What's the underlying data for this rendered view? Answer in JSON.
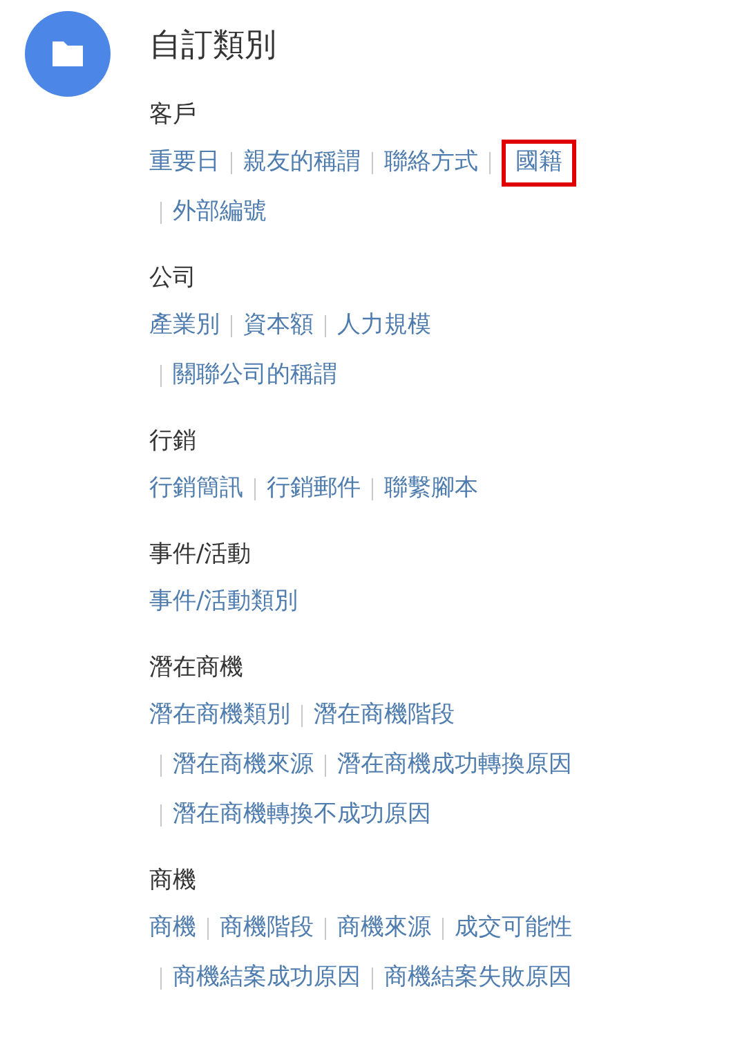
{
  "title": "自訂類別",
  "sections": [
    {
      "heading": "客戶",
      "lines": [
        [
          {
            "label": "重要日",
            "highlighted": false
          },
          {
            "label": "親友的稱謂",
            "highlighted": false
          },
          {
            "label": "聯絡方式",
            "highlighted": false
          },
          {
            "label": "國籍",
            "highlighted": true
          }
        ],
        [
          {
            "label": "外部編號",
            "highlighted": false
          }
        ]
      ]
    },
    {
      "heading": "公司",
      "lines": [
        [
          {
            "label": "產業別",
            "highlighted": false
          },
          {
            "label": "資本額",
            "highlighted": false
          },
          {
            "label": "人力規模",
            "highlighted": false
          }
        ],
        [
          {
            "label": "關聯公司的稱謂",
            "highlighted": false
          }
        ]
      ]
    },
    {
      "heading": "行銷",
      "lines": [
        [
          {
            "label": "行銷簡訊",
            "highlighted": false
          },
          {
            "label": "行銷郵件",
            "highlighted": false
          },
          {
            "label": "聯繫腳本",
            "highlighted": false
          }
        ]
      ]
    },
    {
      "heading": "事件/活動",
      "lines": [
        [
          {
            "label": "事件/活動類別",
            "highlighted": false
          }
        ]
      ]
    },
    {
      "heading": "潛在商機",
      "lines": [
        [
          {
            "label": "潛在商機類別",
            "highlighted": false
          },
          {
            "label": "潛在商機階段",
            "highlighted": false
          }
        ],
        [
          {
            "label": "潛在商機來源",
            "highlighted": false
          },
          {
            "label": "潛在商機成功轉換原因",
            "highlighted": false
          }
        ],
        [
          {
            "label": "潛在商機轉換不成功原因",
            "highlighted": false
          }
        ]
      ]
    },
    {
      "heading": "商機",
      "lines": [
        [
          {
            "label": "商機",
            "highlighted": false
          },
          {
            "label": "商機階段",
            "highlighted": false
          },
          {
            "label": "商機來源",
            "highlighted": false
          },
          {
            "label": "成交可能性",
            "highlighted": false
          }
        ],
        [
          {
            "label": "商機結案成功原因",
            "highlighted": false
          },
          {
            "label": "商機結案失敗原因",
            "highlighted": false
          }
        ]
      ]
    }
  ]
}
